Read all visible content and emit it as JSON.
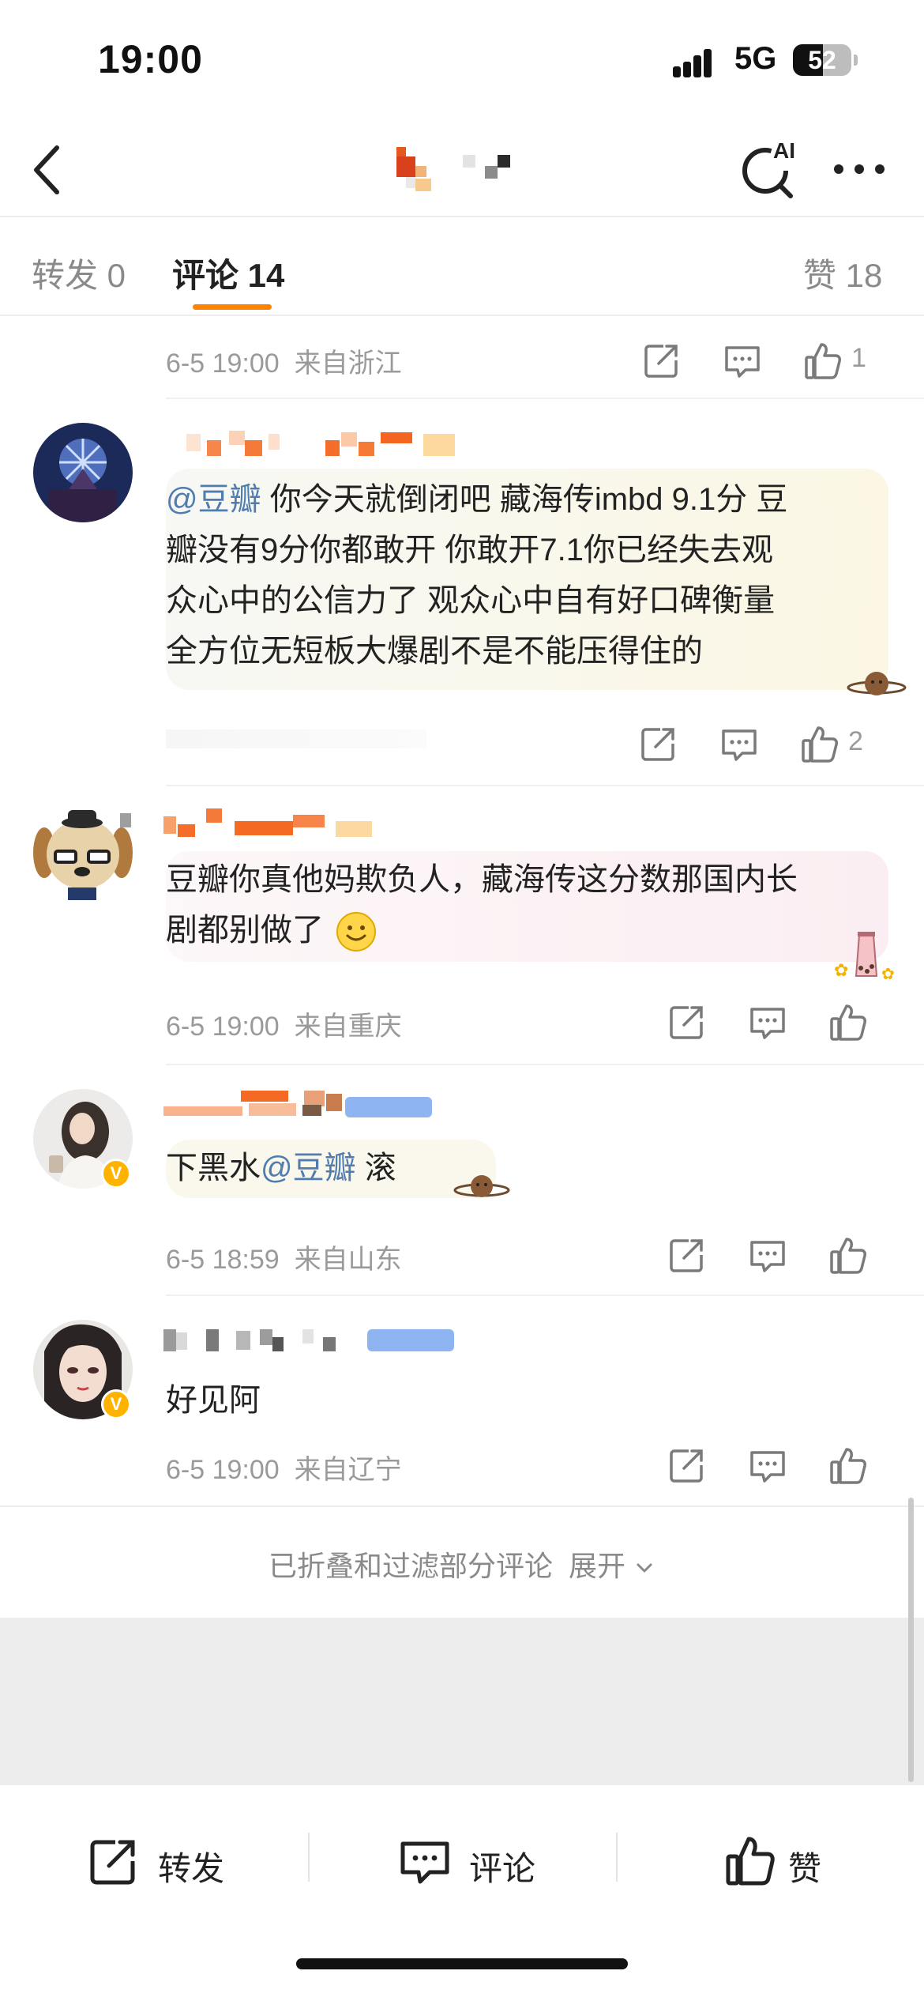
{
  "status_bar": {
    "time": "19:00",
    "network": "5G",
    "battery": "52",
    "battery_fraction": 0.52
  },
  "tabs": {
    "repost": "转发 0",
    "comment": "评论 14",
    "like": "赞 18"
  },
  "top_meta": {
    "time": "6-5 19:00",
    "location": "来自浙江",
    "likes": "1"
  },
  "comments": [
    {
      "mention": "@豆瓣",
      "text_lines": [
        " 你今天就倒闭吧 藏海传imbd 9.1分 豆",
        "瓣没有9分你都敢开 你敢开7.1你已经失去观",
        "众心中的公信力了 观众心中自有好口碑衡量",
        "全方位无短板大爆剧不是不能压得住的"
      ],
      "likes": "2"
    },
    {
      "text_lines": [
        "豆瓣你真他妈欺负人，藏海传这分数那国内长",
        "剧都别做了"
      ],
      "time": "6-5 19:00",
      "location": "来自重庆"
    },
    {
      "text_before": "下黑水",
      "mention": "@豆瓣",
      "text_after": " 滚",
      "time": "6-5 18:59",
      "location": "来自山东"
    },
    {
      "text": "好见阿",
      "time": "6-5 19:00",
      "location": "来自辽宁"
    }
  ],
  "collapse": {
    "text": "已折叠和过滤部分评论",
    "link": "展开"
  },
  "bottom_bar": {
    "repost": "转发",
    "comment": "评论",
    "like": "赞"
  },
  "colors": {
    "accent": "#ff8200",
    "mention": "#507daf",
    "verified": "#ffb300"
  },
  "icons": [
    "back-icon",
    "ai-search-icon",
    "more-icon",
    "share-icon",
    "comment-icon",
    "like-icon",
    "chevron-down-icon",
    "smile-emoji-icon"
  ]
}
